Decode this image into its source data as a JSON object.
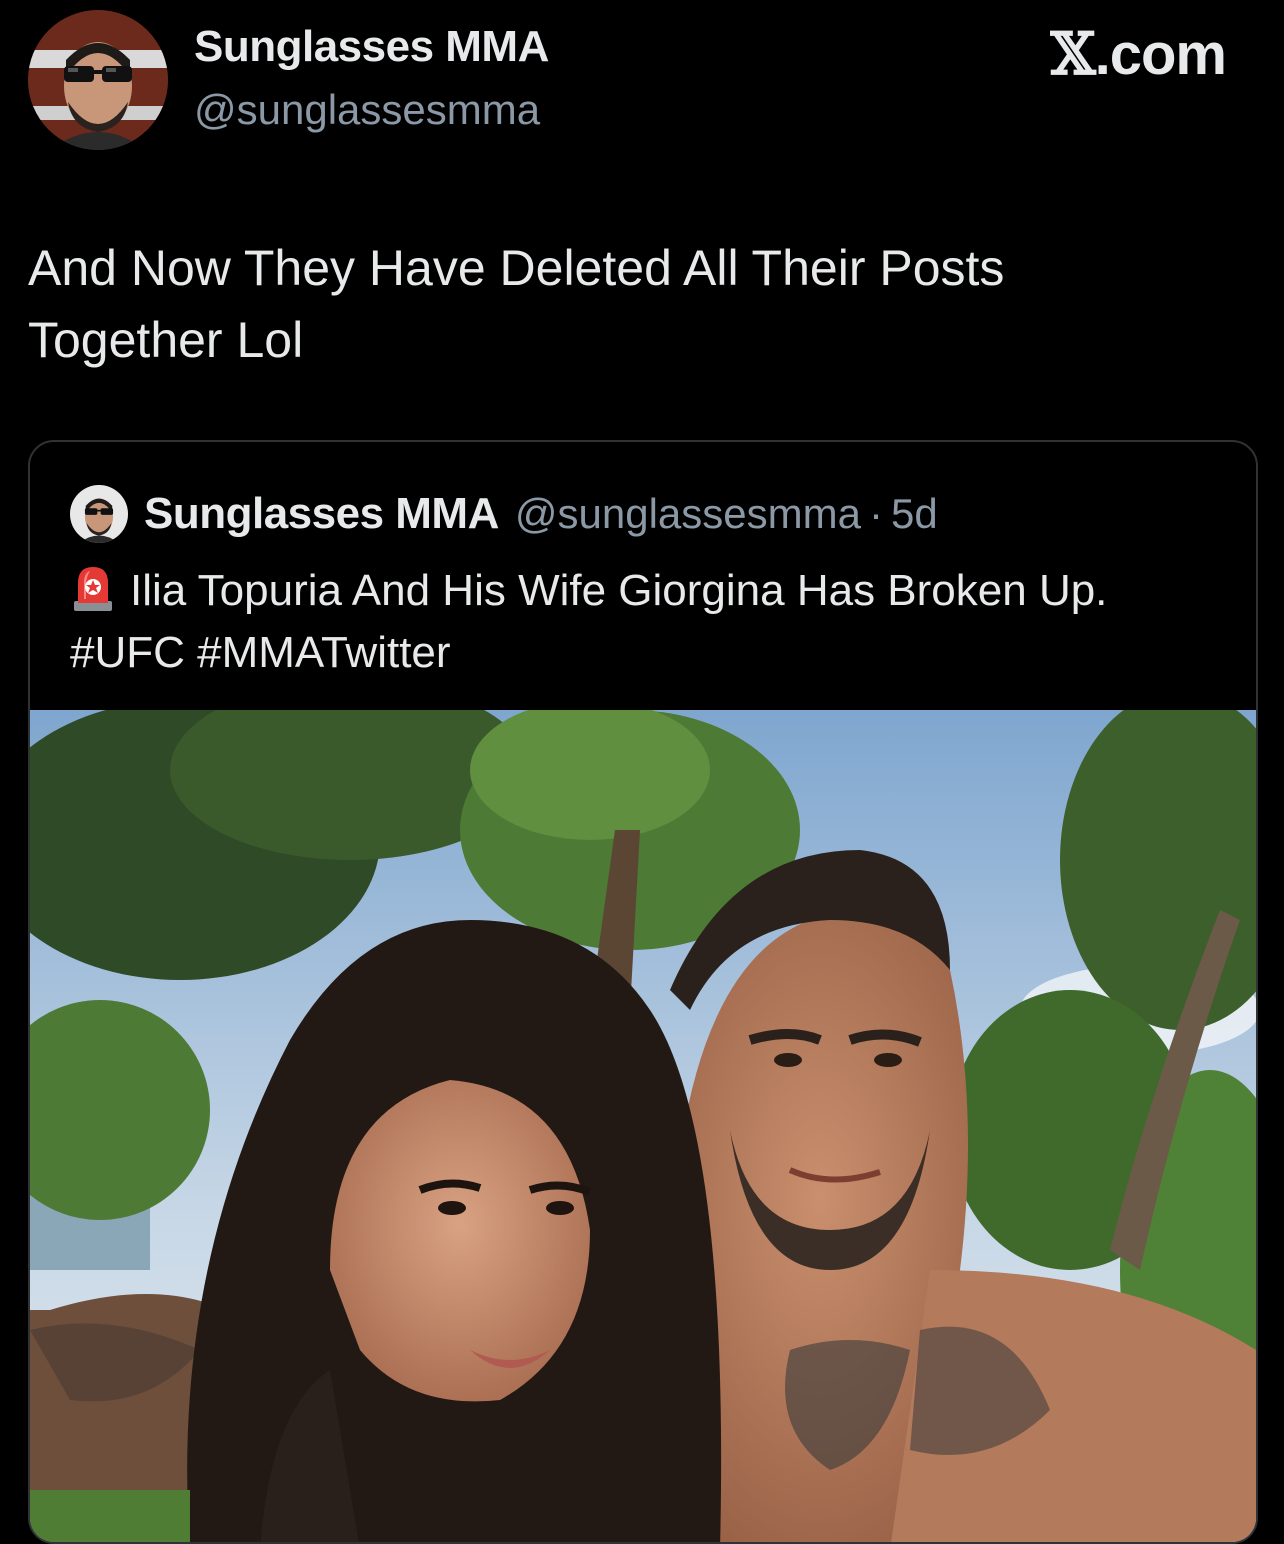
{
  "author": {
    "display_name": "Sunglasses MMA",
    "handle": "@sunglassesmma",
    "avatar_icon": "sunglasses-man-avatar"
  },
  "site": {
    "logo_symbol": "𝕏",
    "logo_text": ".com"
  },
  "post": {
    "text_line1": "And Now They Have Deleted All Their Posts",
    "text_line2": "Together Lol"
  },
  "quoted_post": {
    "display_name": "Sunglasses MMA",
    "handle": "@sunglassesmma",
    "separator": "·",
    "time": "5d",
    "emoji_icon": "rotating-light-siren-icon",
    "text_line1": "Ilia Topuria And His Wife Giorgina Has Broken Up.",
    "text_line2": "#UFC #MMATwitter",
    "media_description_icon": "couple-selfie-photo"
  },
  "colors": {
    "background": "#000000",
    "text_primary": "#e7e9ea",
    "text_secondary": "#8b98a5",
    "border": "#2f3336"
  }
}
